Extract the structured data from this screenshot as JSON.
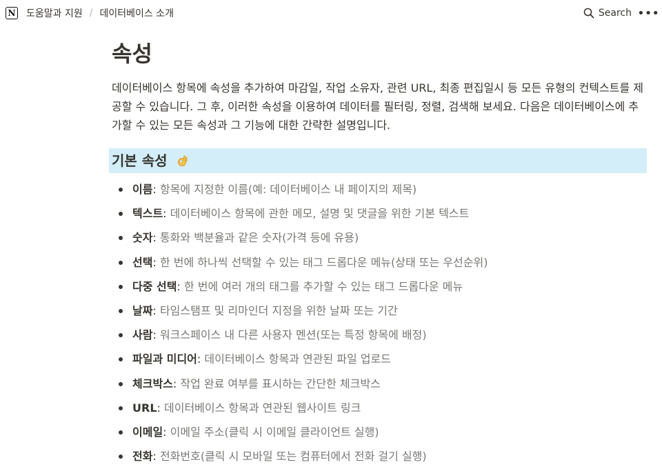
{
  "breadcrumb": {
    "items": [
      "도움말과 지원",
      "데이터베이스 소개"
    ],
    "separator": "/"
  },
  "topbar": {
    "search_label": "Search",
    "more_label": "•••"
  },
  "page": {
    "title": "속성",
    "intro": "데이터베이스 항목에 속성을 추가하여 마감일, 작업 소유자, 관련 URL, 최종 편집일시 등 모든 유형의 컨텍스트를 제공할 수 있습니다. 그 후, 이러한 속성을 이용하여 데이터를 필터링, 정렬, 검색해 보세요. 다음은 데이터베이스에 추가할 수 있는 모든 속성과 그 기능에 대한 간략한 설명입니다."
  },
  "section": {
    "heading": "기본 속성",
    "heading_icon": "ok-hand-emoji",
    "heading_bg": "#d3eef8"
  },
  "properties": [
    {
      "term": "이름",
      "desc": "항목에 지정한 이름(예: 데이터베이스 내 페이지의 제목)"
    },
    {
      "term": "텍스트",
      "desc": "데이터베이스 항목에 관한 메모, 설명 및 댓글을 위한 기본 텍스트"
    },
    {
      "term": "숫자",
      "desc": "통화와 백분율과 같은 숫자(가격 등에 유용)"
    },
    {
      "term": "선택",
      "desc": "한 번에 하나씩 선택할 수 있는 태그 드롭다운 메뉴(상태 또는 우선순위)"
    },
    {
      "term": "다중 선택",
      "desc": "한 번에 여러 개의 태그를 추가할 수 있는 태그 드롭다운 메뉴"
    },
    {
      "term": "날짜",
      "desc": "타임스탬프 및 리마인더 지정을 위한 날짜 또는 기간"
    },
    {
      "term": "사람",
      "desc": "워크스페이스 내 다른 사용자 멘션(또는 특정 항목에 배정)"
    },
    {
      "term": "파일과 미디어",
      "desc": "데이터베이스 항목과 연관된 파일 업로드"
    },
    {
      "term": "체크박스",
      "desc": "작업 완료 여부를 표시하는 간단한 체크박스"
    },
    {
      "term": "URL",
      "desc": "데이터베이스 항목과 연관된 웹사이트 링크"
    },
    {
      "term": "이메일",
      "desc": "이메일 주소(클릭 시 이메일 클라이언트 실행)"
    },
    {
      "term": "전화",
      "desc": "전화번호(클릭 시 모바일 또는 컴퓨터에서 전화 걸기 실행)"
    }
  ],
  "colors": {
    "text": "#37352f",
    "muted": "#787774",
    "heading_bg": "#d3eef8"
  }
}
